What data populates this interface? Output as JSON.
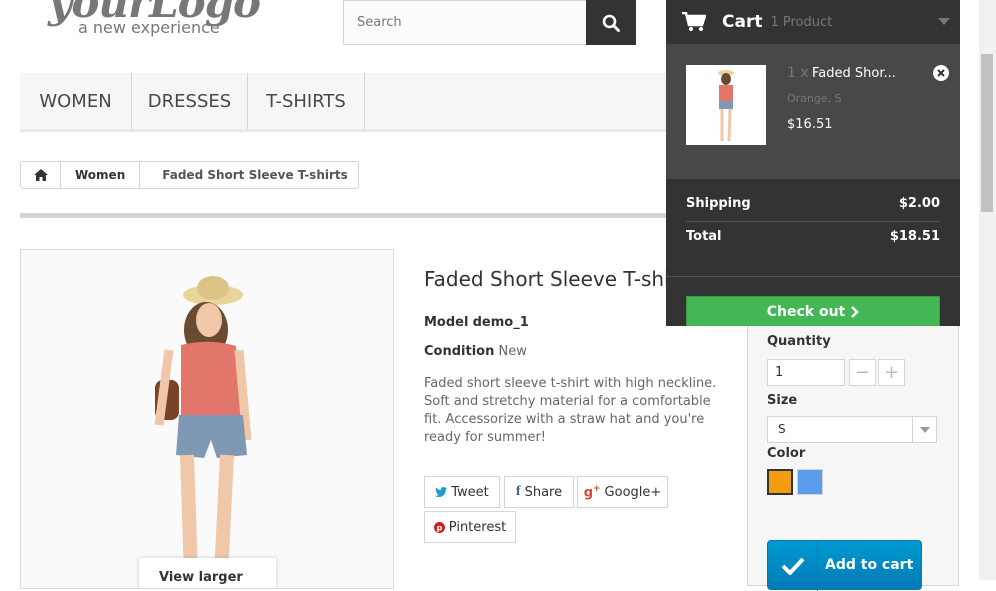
{
  "logo": {
    "script": "yourLogo",
    "tagline": "a new experience",
    "icon": "logo-image"
  },
  "search": {
    "placeholder": "Search",
    "icon": "search-icon"
  },
  "menu": {
    "items": [
      "WOMEN",
      "DRESSES",
      "T-SHIRTS"
    ]
  },
  "breadcrumb": {
    "home_icon": "home-icon",
    "items": [
      "Women"
    ],
    "current": "Faded Short Sleeve T-shirts"
  },
  "product": {
    "title": "Faded Short Sleeve T-shirts",
    "model_label": "Model",
    "model_value": "demo_1",
    "condition_label": "Condition",
    "condition_value": "New",
    "description": "Faded short sleeve t-shirt with high neckline. Soft and stretchy material for a comfortable fit. Accessorize with a straw hat and you're ready for summer!",
    "view_larger": "View larger",
    "image_icon": "product-photo"
  },
  "social": {
    "tweet": "Tweet",
    "share": "Share",
    "google": "Google+",
    "pinterest": "Pinterest"
  },
  "buy": {
    "quantity_label": "Quantity",
    "quantity_value": "1",
    "size_label": "Size",
    "size_value": "S",
    "color_label": "Color",
    "colors": [
      "#f39c11",
      "#5d9cec"
    ],
    "add_to_cart": "Add to cart"
  },
  "cart": {
    "title": "Cart",
    "count": "1 Product",
    "item": {
      "qty": "1 x",
      "name": "Faded Shor...",
      "attrs": "Orange, S",
      "price": "$16.51"
    },
    "shipping_label": "Shipping",
    "shipping_value": "$2.00",
    "total_label": "Total",
    "total_value": "$18.51",
    "checkout": "Check out"
  }
}
